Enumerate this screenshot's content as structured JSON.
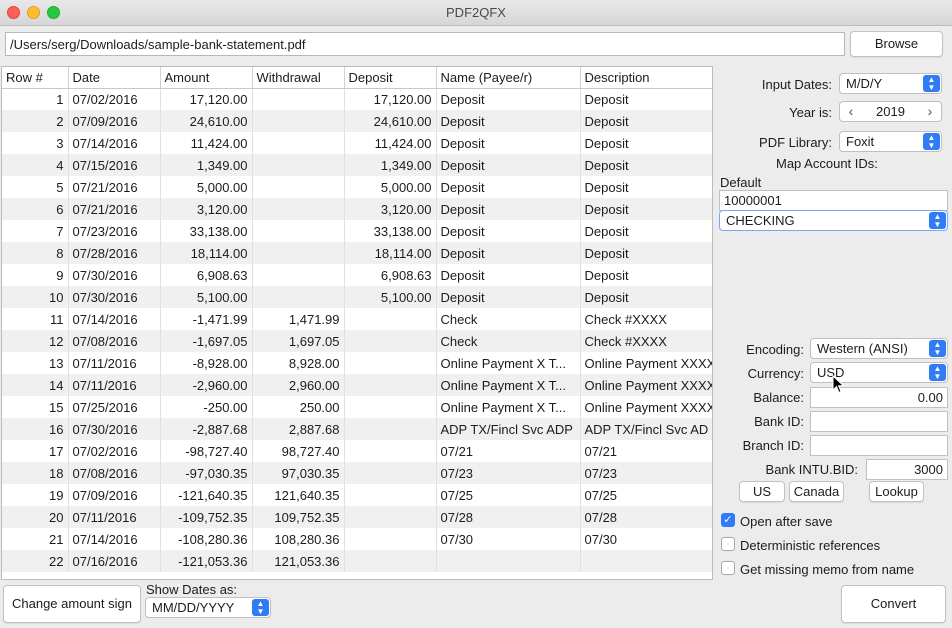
{
  "window": {
    "title": "PDF2QFX"
  },
  "file": {
    "path": "/Users/serg/Downloads/sample-bank-statement.pdf",
    "browse_label": "Browse"
  },
  "table": {
    "columns": [
      "Row #",
      "Date",
      "Amount",
      "Withdrawal",
      "Deposit",
      "Name (Payee/r)",
      "Description"
    ],
    "rows": [
      [
        "1",
        "07/02/2016",
        "17,120.00",
        "",
        "17,120.00",
        "Deposit",
        "Deposit"
      ],
      [
        "2",
        "07/09/2016",
        "24,610.00",
        "",
        "24,610.00",
        "Deposit",
        "Deposit"
      ],
      [
        "3",
        "07/14/2016",
        "11,424.00",
        "",
        "11,424.00",
        "Deposit",
        "Deposit"
      ],
      [
        "4",
        "07/15/2016",
        "1,349.00",
        "",
        "1,349.00",
        "Deposit",
        "Deposit"
      ],
      [
        "5",
        "07/21/2016",
        "5,000.00",
        "",
        "5,000.00",
        "Deposit",
        "Deposit"
      ],
      [
        "6",
        "07/21/2016",
        "3,120.00",
        "",
        "3,120.00",
        "Deposit",
        "Deposit"
      ],
      [
        "7",
        "07/23/2016",
        "33,138.00",
        "",
        "33,138.00",
        "Deposit",
        "Deposit"
      ],
      [
        "8",
        "07/28/2016",
        "18,114.00",
        "",
        "18,114.00",
        "Deposit",
        "Deposit"
      ],
      [
        "9",
        "07/30/2016",
        "6,908.63",
        "",
        "6,908.63",
        "Deposit",
        "Deposit"
      ],
      [
        "10",
        "07/30/2016",
        "5,100.00",
        "",
        "5,100.00",
        "Deposit",
        "Deposit"
      ],
      [
        "11",
        "07/14/2016",
        "-1,471.99",
        "1,471.99",
        "",
        "Check",
        "Check #XXXX"
      ],
      [
        "12",
        "07/08/2016",
        "-1,697.05",
        "1,697.05",
        "",
        "Check",
        "Check #XXXX"
      ],
      [
        "13",
        "07/11/2016",
        "-8,928.00",
        "8,928.00",
        "",
        "Online Payment X T...",
        "Online Payment XXXX"
      ],
      [
        "14",
        "07/11/2016",
        "-2,960.00",
        "2,960.00",
        "",
        "Online Payment X T...",
        "Online Payment XXXX"
      ],
      [
        "15",
        "07/25/2016",
        "-250.00",
        "250.00",
        "",
        "Online Payment X T...",
        "Online Payment XXXX"
      ],
      [
        "16",
        "07/30/2016",
        "-2,887.68",
        "2,887.68",
        "",
        "ADP TX/Fincl Svc ADP",
        "ADP TX/Fincl Svc AD"
      ],
      [
        "17",
        "07/02/2016",
        "-98,727.40",
        "98,727.40",
        "",
        "07/21",
        "07/21"
      ],
      [
        "18",
        "07/08/2016",
        "-97,030.35",
        "97,030.35",
        "",
        "07/23",
        "07/23"
      ],
      [
        "19",
        "07/09/2016",
        "-121,640.35",
        "121,640.35",
        "",
        "07/25",
        "07/25"
      ],
      [
        "20",
        "07/11/2016",
        "-109,752.35",
        "109,752.35",
        "",
        "07/28",
        "07/28"
      ],
      [
        "21",
        "07/14/2016",
        "-108,280.36",
        "108,280.36",
        "",
        "07/30",
        "07/30"
      ],
      [
        "22",
        "07/16/2016",
        "-121,053.36",
        "121,053.36",
        "",
        "",
        ""
      ]
    ]
  },
  "settings": {
    "input_dates_label": "Input Dates:",
    "input_dates_value": "M/D/Y",
    "year_label": "Year is:",
    "year_value": "2019",
    "year_dec": "‹",
    "year_inc": "›",
    "pdf_library_label": "PDF Library:",
    "pdf_library_value": "Foxit",
    "map_accounts_label": "Map Account IDs:",
    "default_label": "Default",
    "account_id_value": "10000001",
    "account_type_value": "CHECKING",
    "encoding_label": "Encoding:",
    "encoding_value": "Western (ANSI)",
    "currency_label": "Currency:",
    "currency_value": "USD",
    "balance_label": "Balance:",
    "balance_value": "0.00",
    "bank_id_label": "Bank ID:",
    "bank_id_value": "",
    "branch_id_label": "Branch ID:",
    "branch_id_value": "",
    "intu_bid_label": "Bank INTU.BID:",
    "intu_bid_value": "3000",
    "us_label": "US",
    "canada_label": "Canada",
    "lookup_label": "Lookup",
    "open_after_save_label": "Open after save",
    "open_after_save_checked": true,
    "deterministic_label": "Deterministic references",
    "deterministic_checked": false,
    "missing_memo_label": "Get missing memo from name",
    "missing_memo_checked": false
  },
  "bottom": {
    "change_sign_label": "Change amount sign",
    "show_dates_label": "Show Dates as:",
    "show_dates_value": "MM/DD/YYYY",
    "convert_label": "Convert"
  },
  "colors": {
    "accent": "#2f7cf6",
    "row_stripe": "#f0f0f0"
  },
  "icons": {
    "select_arrow": "updown-chevron-icon",
    "pointer": "mouse-pointer-icon"
  }
}
